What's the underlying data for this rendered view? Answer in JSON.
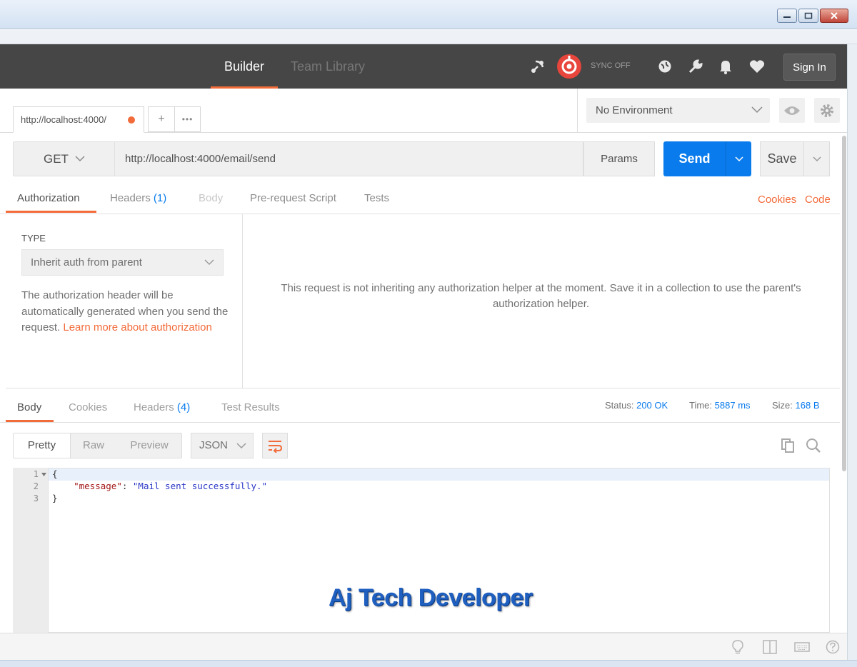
{
  "header": {
    "tabs": [
      {
        "label": "Builder",
        "active": true
      },
      {
        "label": "Team Library",
        "active": false
      }
    ],
    "sync_label": "SYNC OFF",
    "signin_label": "Sign In"
  },
  "request_tab": {
    "title": "http://localhost:4000/",
    "new_tab": "+",
    "more": "•••"
  },
  "environment": {
    "selected": "No Environment"
  },
  "request": {
    "method": "GET",
    "url": "http://localhost:4000/email/send",
    "params_label": "Params",
    "send_label": "Send",
    "save_label": "Save"
  },
  "request_tabs": {
    "authorization": "Authorization",
    "headers": "Headers",
    "headers_count": "(1)",
    "body": "Body",
    "prerequest": "Pre-request Script",
    "tests": "Tests",
    "cookies_link": "Cookies",
    "code_link": "Code"
  },
  "auth": {
    "type_label": "TYPE",
    "type_value": "Inherit auth from parent",
    "description": "The authorization header will be automatically generated when you send the request.",
    "learn_more": "Learn more about authorization",
    "message": "This request is not inheriting any authorization helper at the moment. Save it in a collection to use the parent's authorization helper."
  },
  "response": {
    "tabs": {
      "body": "Body",
      "cookies": "Cookies",
      "headers": "Headers",
      "headers_count": "(4)",
      "test_results": "Test Results"
    },
    "status_label": "Status:",
    "status_value": "200 OK",
    "time_label": "Time:",
    "time_value": "5887 ms",
    "size_label": "Size:",
    "size_value": "168 B",
    "formats": [
      "Pretty",
      "Raw",
      "Preview"
    ],
    "language": "JSON",
    "lines": [
      {
        "n": "1",
        "text": "{"
      },
      {
        "n": "2",
        "key": "\"message\"",
        "value": "\"Mail sent successfully.\""
      },
      {
        "n": "3",
        "text": "}"
      }
    ]
  },
  "watermark": "Aj Tech Developer",
  "colors": {
    "accent": "#f26b3a",
    "primary": "#097bed",
    "header_bg": "#464646"
  }
}
